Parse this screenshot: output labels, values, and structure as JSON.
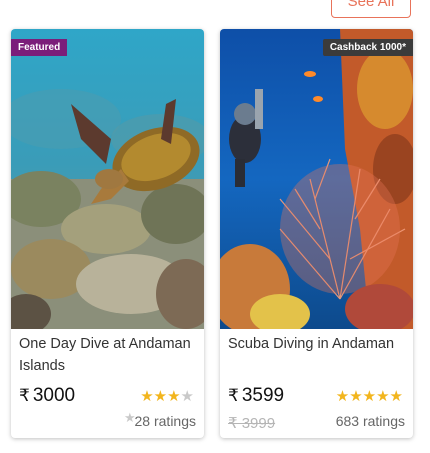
{
  "header": {
    "see_all_label": "See All"
  },
  "cards": [
    {
      "badge": "Featured",
      "title": "One Day Dive at Andaman Islands",
      "currency": "₹",
      "price": "3000",
      "old_price": "",
      "rating_stars": 3,
      "rating_max": 4,
      "ratings_count": "28 ratings",
      "image": "sea-turtle-over-coral-reef"
    },
    {
      "badge": "Cashback 1000*",
      "title": "Scuba Diving in Andaman",
      "currency": "₹",
      "price": "3599",
      "old_price": "₹ 3999",
      "rating_stars": 5,
      "rating_max": 5,
      "ratings_count": "683 ratings",
      "image": "scuba-diver-with-red-sea-fan"
    }
  ],
  "colors": {
    "accent": "#e8735a",
    "featured_badge": "#7b1e7a",
    "cashback_badge": "#3b3b3b",
    "star_filled": "#f2b51d",
    "star_empty": "#c9c9c9"
  }
}
